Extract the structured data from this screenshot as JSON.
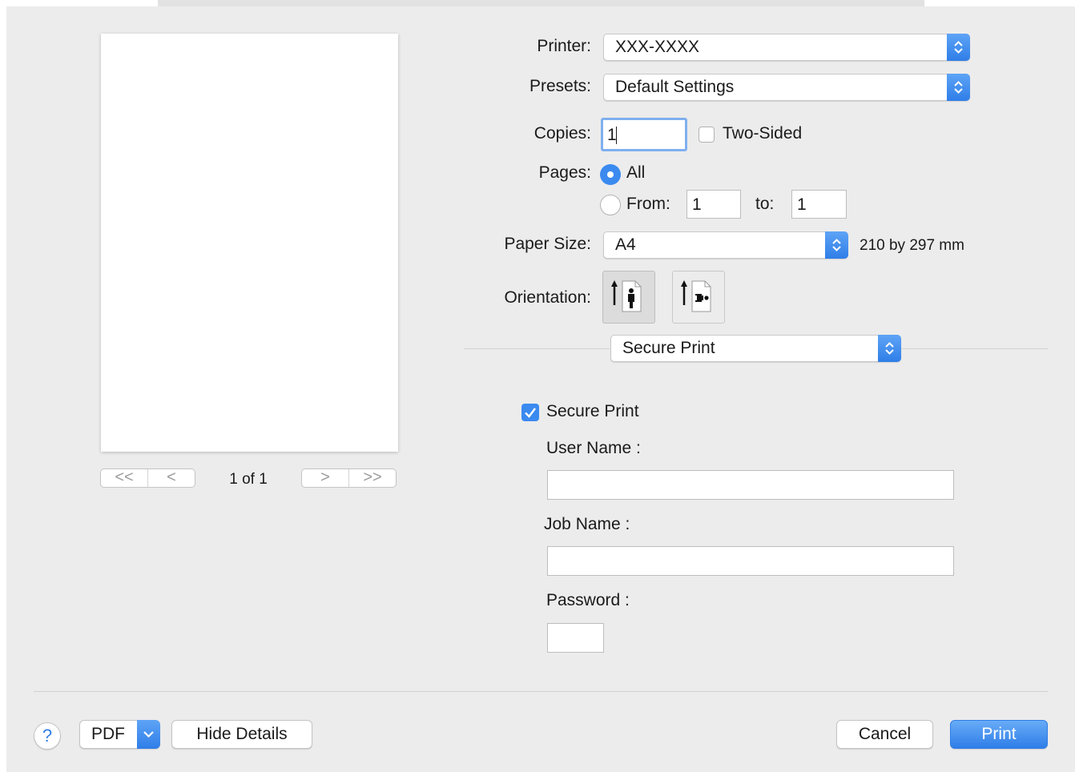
{
  "preview": {
    "page_indicator": "1 of 1",
    "first_label": "<<",
    "prev_label": "<",
    "next_label": ">",
    "last_label": ">>"
  },
  "printer": {
    "label": "Printer:",
    "value": "XXX-XXXX"
  },
  "presets": {
    "label": "Presets:",
    "value": "Default Settings"
  },
  "copies": {
    "label": "Copies:",
    "value": "1",
    "two_sided_label": "Two-Sided",
    "two_sided_checked": false
  },
  "pages": {
    "label": "Pages:",
    "all_label": "All",
    "from_label": "From:",
    "from_value": "1",
    "to_label": "to:",
    "to_value": "1",
    "selected": "All"
  },
  "paper_size": {
    "label": "Paper Size:",
    "value": "A4",
    "dimensions": "210 by 297 mm"
  },
  "orientation": {
    "label": "Orientation:",
    "selected": "portrait"
  },
  "section_popup": {
    "value": "Secure Print"
  },
  "secure_print": {
    "checkbox_label": "Secure Print",
    "checked": true,
    "user_name_label": "User Name :",
    "user_name_value": "",
    "job_name_label": "Job Name :",
    "job_name_value": "",
    "password_label": "Password :",
    "password_value": ""
  },
  "footer": {
    "help_label": "?",
    "pdf_label": "PDF",
    "hide_details_label": "Hide Details",
    "cancel_label": "Cancel",
    "print_label": "Print"
  },
  "colors": {
    "accent": "#3b8af0",
    "dialog_bg": "#ececec"
  }
}
